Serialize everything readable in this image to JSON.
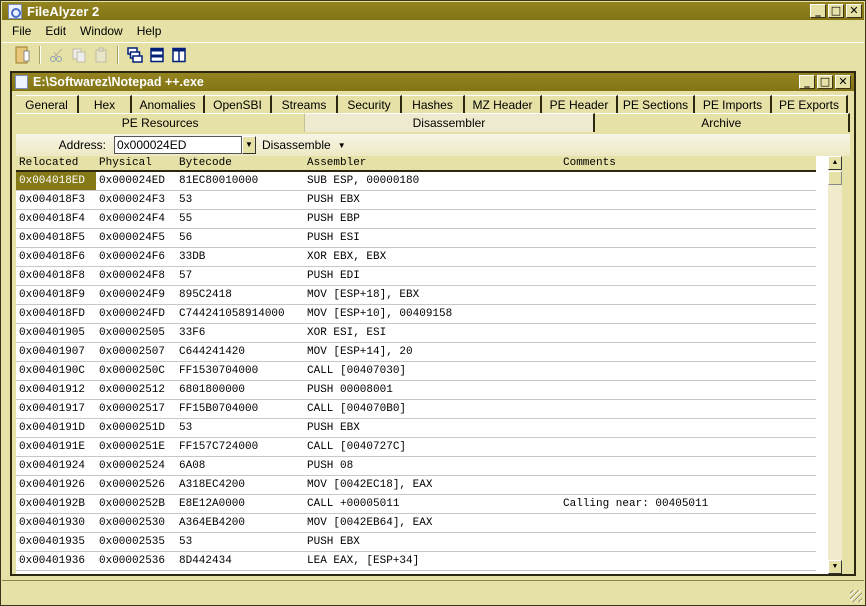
{
  "app": {
    "title": "FileAlyzer 2"
  },
  "window_buttons": {
    "minimize": "_",
    "maximize": "□",
    "close": "✕"
  },
  "menu": [
    "File",
    "Edit",
    "Window",
    "Help"
  ],
  "toolbar": {
    "buttons": [
      {
        "icon": "open-file-icon",
        "enabled": true
      },
      {
        "icon": "cut-icon",
        "enabled": false
      },
      {
        "icon": "copy-icon",
        "enabled": false
      },
      {
        "icon": "paste-icon",
        "enabled": false
      },
      {
        "icon": "cascade-windows-icon",
        "enabled": true
      },
      {
        "icon": "tile-horizontal-icon",
        "enabled": true
      },
      {
        "icon": "tile-vertical-icon",
        "enabled": true
      }
    ]
  },
  "document": {
    "title": "E:\\Softwarez\\Notepad ++.exe",
    "tabs_row1": [
      "General",
      "Hex",
      "Anomalies",
      "OpenSBI",
      "Streams",
      "Security",
      "Hashes",
      "MZ Header",
      "PE Header",
      "PE Sections",
      "PE Imports",
      "PE Exports"
    ],
    "tabs_row2": [
      "PE Resources",
      "Disassembler",
      "Archive"
    ],
    "active_tab": "Disassembler",
    "address": {
      "label": "Address:",
      "value": "0x000024ED"
    },
    "mode": {
      "label": "Disassemble"
    },
    "columns": [
      "Relocated",
      "Physical",
      "Bytecode",
      "Assembler",
      "Comments"
    ],
    "rows": [
      [
        "0x004018ED",
        "0x000024ED",
        "81EC80010000",
        "SUB ESP, 00000180",
        ""
      ],
      [
        "0x004018F3",
        "0x000024F3",
        "53",
        "PUSH EBX",
        ""
      ],
      [
        "0x004018F4",
        "0x000024F4",
        "55",
        "PUSH EBP",
        ""
      ],
      [
        "0x004018F5",
        "0x000024F5",
        "56",
        "PUSH ESI",
        ""
      ],
      [
        "0x004018F6",
        "0x000024F6",
        "33DB",
        "XOR EBX, EBX",
        ""
      ],
      [
        "0x004018F8",
        "0x000024F8",
        "57",
        "PUSH EDI",
        ""
      ],
      [
        "0x004018F9",
        "0x000024F9",
        "895C2418",
        "MOV [ESP+18], EBX",
        ""
      ],
      [
        "0x004018FD",
        "0x000024FD",
        "C744241058914000",
        "MOV [ESP+10], 00409158",
        ""
      ],
      [
        "0x00401905",
        "0x00002505",
        "33F6",
        "XOR ESI, ESI",
        ""
      ],
      [
        "0x00401907",
        "0x00002507",
        "C644241420",
        "MOV [ESP+14], 20",
        ""
      ],
      [
        "0x0040190C",
        "0x0000250C",
        "FF1530704000",
        "CALL [00407030]",
        ""
      ],
      [
        "0x00401912",
        "0x00002512",
        "6801800000",
        "PUSH 00008001",
        ""
      ],
      [
        "0x00401917",
        "0x00002517",
        "FF15B0704000",
        "CALL [004070B0]",
        ""
      ],
      [
        "0x0040191D",
        "0x0000251D",
        "53",
        "PUSH EBX",
        ""
      ],
      [
        "0x0040191E",
        "0x0000251E",
        "FF157C724000",
        "CALL [0040727C]",
        ""
      ],
      [
        "0x00401924",
        "0x00002524",
        "6A08",
        "PUSH 08",
        ""
      ],
      [
        "0x00401926",
        "0x00002526",
        "A318EC4200",
        "MOV [0042EC18], EAX",
        ""
      ],
      [
        "0x0040192B",
        "0x0000252B",
        "E8E12A0000",
        "CALL +00005011",
        "Calling near: 00405011"
      ],
      [
        "0x00401930",
        "0x00002530",
        "A364EB4200",
        "MOV [0042EB64], EAX",
        ""
      ],
      [
        "0x00401935",
        "0x00002535",
        "53",
        "PUSH EBX",
        ""
      ],
      [
        "0x00401936",
        "0x00002536",
        "8D442434",
        "LEA EAX, [ESP+34]",
        ""
      ]
    ],
    "selected_row": 0
  },
  "colors": {
    "title_bar": "#8a7c1a",
    "face": "#e6e1a6",
    "selection": "#857816"
  }
}
